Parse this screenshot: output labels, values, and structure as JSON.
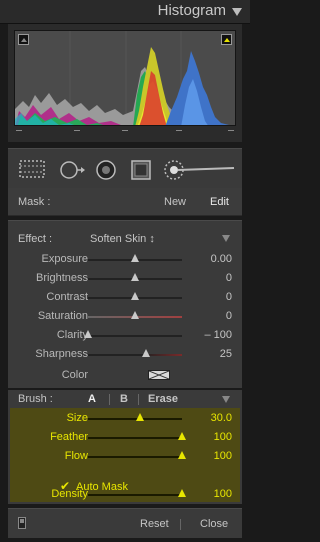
{
  "histogram": {
    "title": "Histogram"
  },
  "mask": {
    "label": "Mask :",
    "new": "New",
    "edit": "Edit"
  },
  "effect": {
    "label": "Effect :",
    "value": "Soften Skin ↕",
    "sliders": [
      {
        "name": "Exposure",
        "value": "0.00",
        "level": 0.5
      },
      {
        "name": "Brightness",
        "value": "0",
        "level": 0.5
      },
      {
        "name": "Contrast",
        "value": "0",
        "level": 0.5
      },
      {
        "name": "Saturation",
        "value": "0",
        "level": 0.5
      },
      {
        "name": "Clarity",
        "value": "– 100",
        "level": 0.0
      },
      {
        "name": "Sharpness",
        "value": "25",
        "level": 0.62
      }
    ],
    "color_label": "Color"
  },
  "brush": {
    "label": "Brush :",
    "a": "A",
    "b": "B",
    "erase": "Erase",
    "sliders": [
      {
        "name": "Size",
        "value": "30.0",
        "level": 0.55
      },
      {
        "name": "Feather",
        "value": "100",
        "level": 1.0
      },
      {
        "name": "Flow",
        "value": "100",
        "level": 1.0
      }
    ],
    "auto_mask": "Auto Mask",
    "auto_mask_checked": true,
    "density": {
      "name": "Density",
      "value": "100",
      "level": 1.0
    },
    "highlight_color": "#e8e600"
  },
  "footer": {
    "reset": "Reset",
    "close": "Close"
  }
}
